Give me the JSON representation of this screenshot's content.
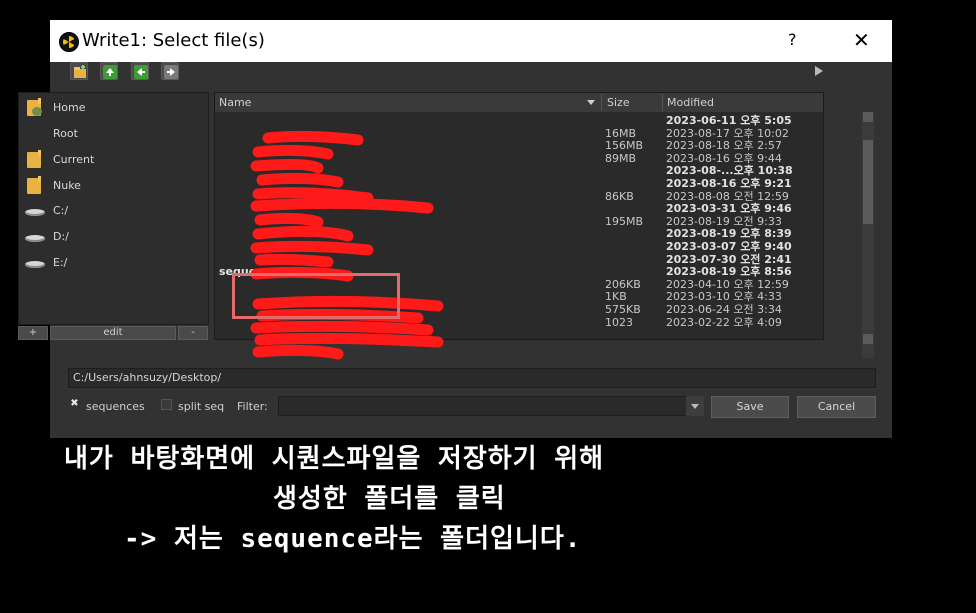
{
  "dialog": {
    "title": "Write1: Select file(s)",
    "help": "?",
    "close": "✕"
  },
  "toolbar": {
    "icons": [
      "new-folder-icon",
      "up-arrow-icon",
      "back-arrow-icon",
      "forward-arrow-icon"
    ]
  },
  "sidebar": {
    "items": [
      {
        "label": "Home",
        "icon": "home-folder-icon"
      },
      {
        "label": "Root",
        "icon": "none"
      },
      {
        "label": "Current",
        "icon": "folder-icon"
      },
      {
        "label": "Nuke",
        "icon": "folder-icon"
      },
      {
        "label": "C:/",
        "icon": "drive-icon"
      },
      {
        "label": "D:/",
        "icon": "drive-icon"
      },
      {
        "label": "E:/",
        "icon": "drive-icon"
      }
    ],
    "add": "+",
    "edit": "edit",
    "remove": "-"
  },
  "list": {
    "headers": {
      "name": "Name",
      "size": "Size",
      "modified": "Modified"
    },
    "rows": [
      {
        "name": "",
        "size": "",
        "modified": "2023-06-11 오후 5:05",
        "bold": true
      },
      {
        "name": "",
        "size": "16MB",
        "modified": "2023-08-17 오후 10:02",
        "bold": false
      },
      {
        "name": "",
        "size": "156MB",
        "modified": "2023-08-18 오후 2:57",
        "bold": false
      },
      {
        "name": "",
        "size": "89MB",
        "modified": "2023-08-16 오후 9:44",
        "bold": false
      },
      {
        "name": "",
        "size": "",
        "modified": "2023-08-...오후 10:38",
        "bold": true
      },
      {
        "name": "",
        "size": "",
        "modified": "2023-08-16 오후 9:21",
        "bold": true
      },
      {
        "name": "",
        "size": "86KB",
        "modified": "2023-08-08 오전 12:59",
        "bold": false
      },
      {
        "name": "",
        "size": "",
        "modified": "2023-03-31 오후 9:46",
        "bold": true
      },
      {
        "name": "",
        "size": "195MB",
        "modified": "2023-08-19 오전 9:33",
        "bold": false
      },
      {
        "name": "",
        "size": "",
        "modified": "2023-08-19 오후 8:39",
        "bold": true
      },
      {
        "name": "",
        "size": "",
        "modified": "2023-03-07 오후 9:40",
        "bold": true
      },
      {
        "name": "",
        "size": "",
        "modified": "2023-07-30 오전 2:41",
        "bold": true
      },
      {
        "name": "sequence/",
        "size": "",
        "modified": "2023-08-19 오후 8:56",
        "bold": true
      },
      {
        "name": "",
        "size": "206KB",
        "modified": "2023-04-10 오후 12:59",
        "bold": false
      },
      {
        "name": "",
        "size": "1KB",
        "modified": "2023-03-10 오후 4:33",
        "bold": false
      },
      {
        "name": "",
        "size": "575KB",
        "modified": "2023-06-24 오전 3:34",
        "bold": false
      },
      {
        "name": "",
        "size": "1023",
        "modified": "2023-02-22 오후 4:09",
        "bold": false
      }
    ]
  },
  "path": "C:/Users/ahnsuzy/Desktop/",
  "options": {
    "sequences_label": "sequences",
    "sequences_checked": "✖",
    "split_seq_label": "split seq",
    "filter_label": "Filter:"
  },
  "buttons": {
    "save": "Save",
    "cancel": "Cancel"
  },
  "caption": {
    "line1": "내가 바탕화면에 시퀀스파일을 저장하기 위해",
    "line2": "생성한 폴더를 클릭",
    "line3": "-> 저는 sequence라는 폴더입니다."
  },
  "colors": {
    "highlight": "#e26b6b",
    "redaction": "#ff1a1a"
  }
}
